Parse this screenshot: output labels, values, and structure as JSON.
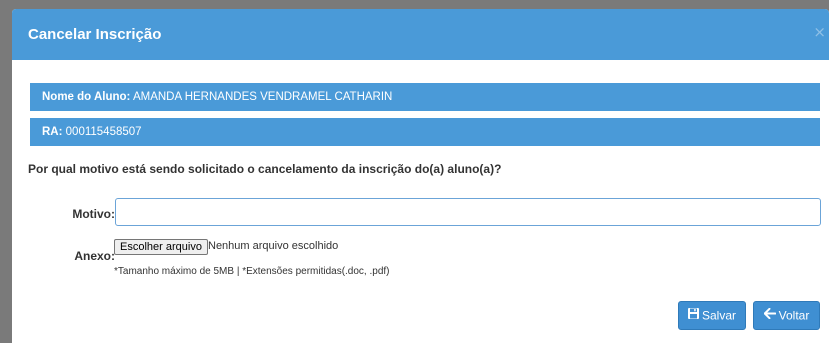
{
  "modal": {
    "title": "Cancelar Inscrição",
    "close_label": "×"
  },
  "student": {
    "name_label": "Nome do Aluno:",
    "name_value": "AMANDA HERNANDES VENDRAMEL CATHARIN",
    "ra_label": "RA:",
    "ra_value": "000115458507"
  },
  "form": {
    "question": "Por qual motivo está sendo solicitado o cancelamento da inscrição do(a) aluno(a)?",
    "motivo_label": "Motivo:",
    "motivo_value": "",
    "anexo_label": "Anexo:",
    "file_button_label": "Escolher arquivo",
    "file_status": "Nenhum arquivo escolhido",
    "file_hint": "*Tamanho máximo de 5MB | *Extensões permitidas(.doc, .pdf)"
  },
  "actions": {
    "save_label": "Salvar",
    "back_label": "Voltar"
  },
  "colors": {
    "header_blue": "#4a9ad8",
    "button_blue": "#3f8fd2",
    "overlay_gray": "#7a7a7a"
  },
  "icons": {
    "save": "floppy-disk-icon",
    "back": "arrow-left-icon"
  }
}
